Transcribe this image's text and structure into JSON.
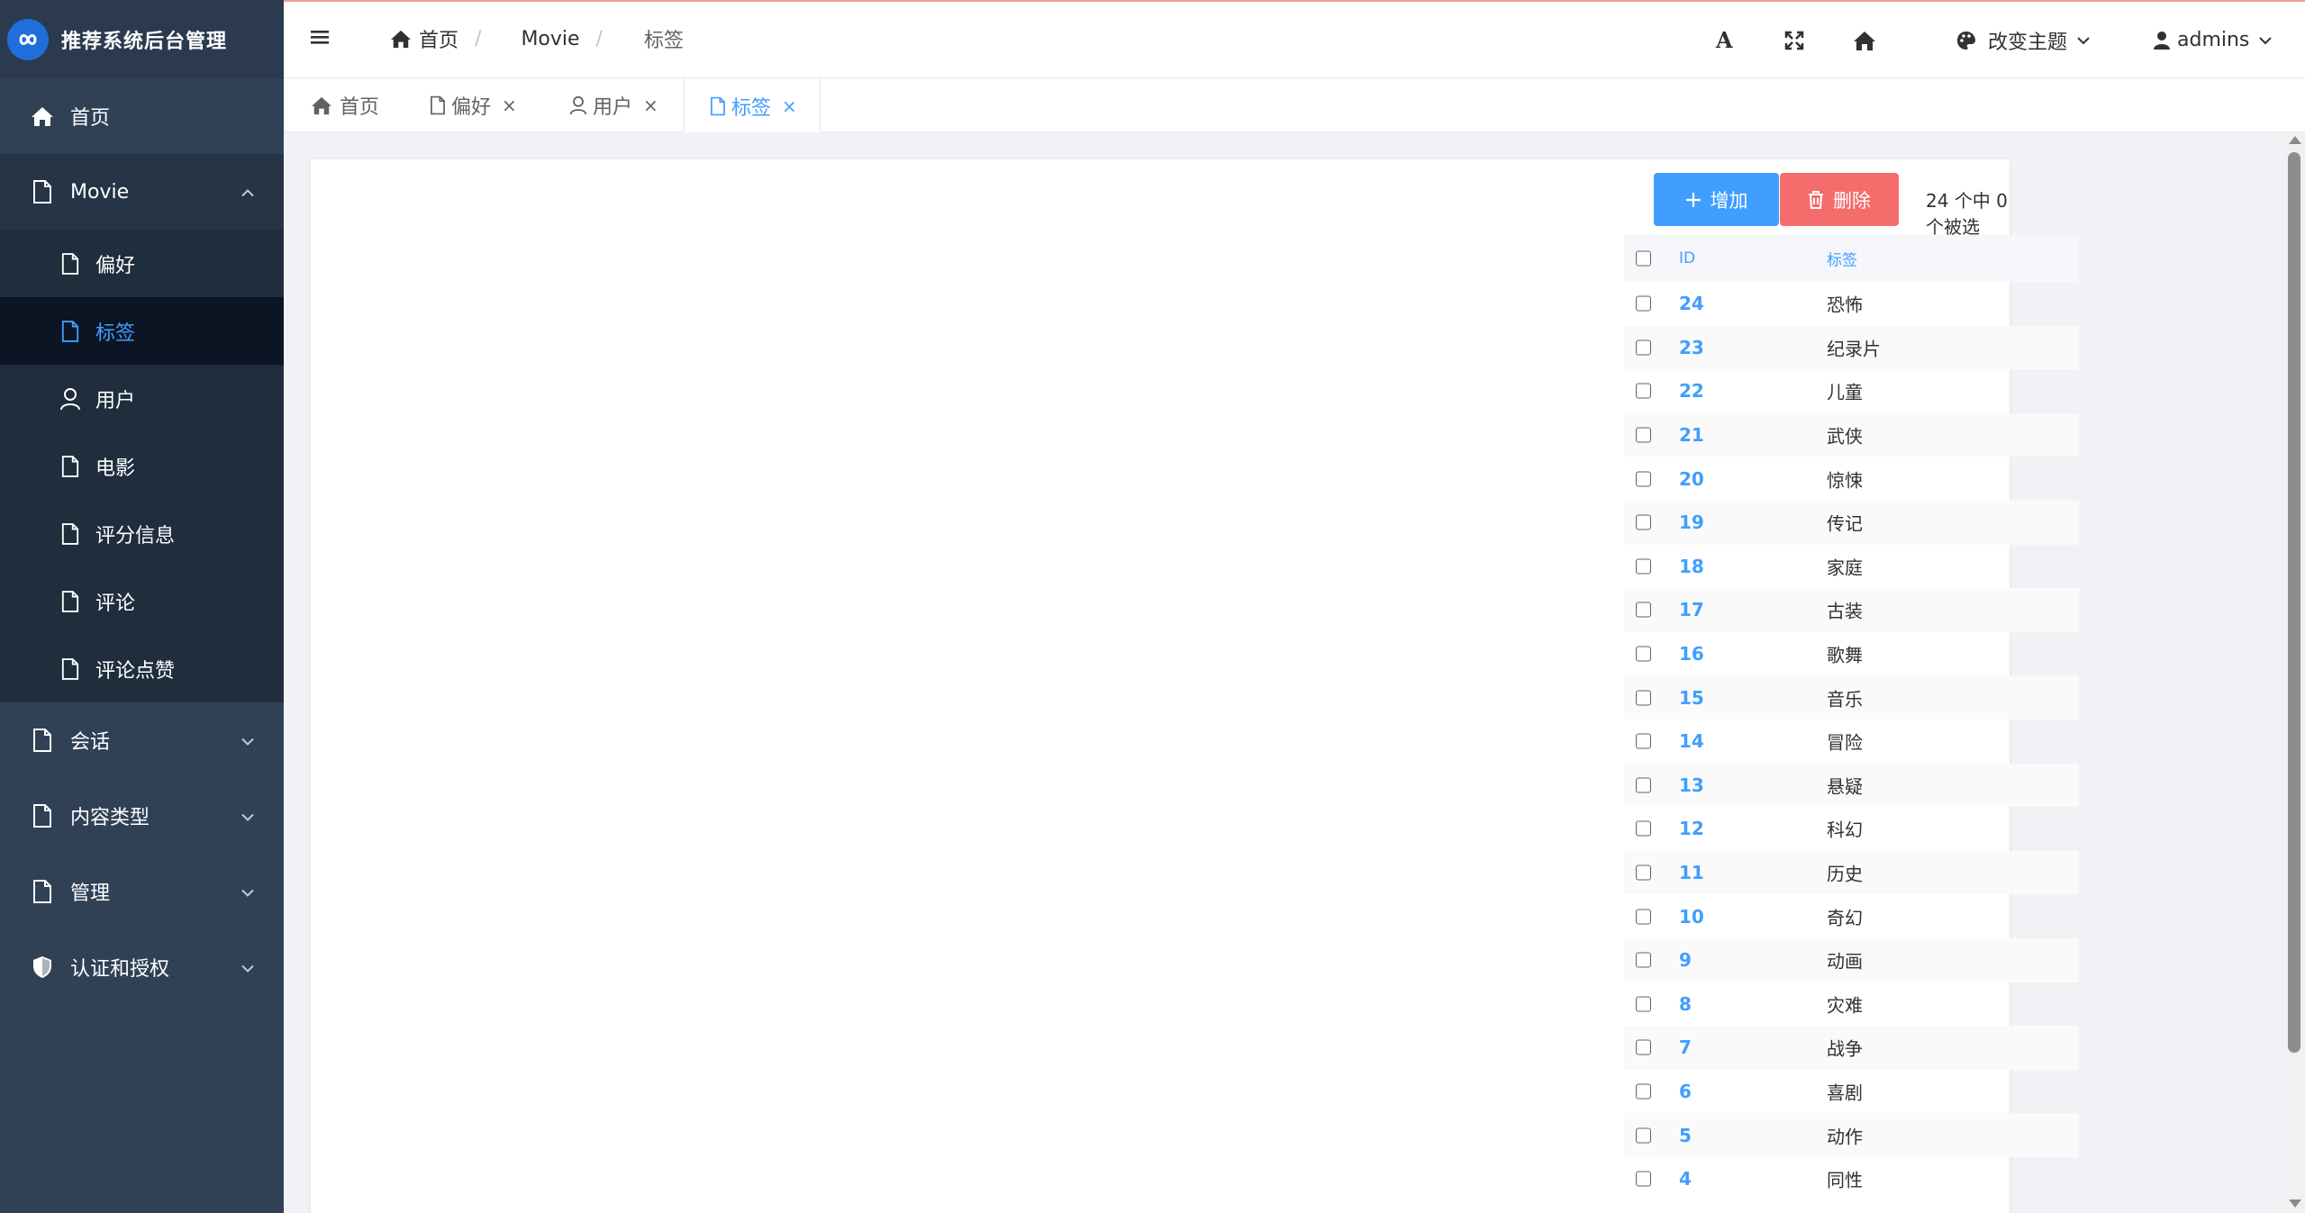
{
  "app": {
    "title": "推荐系统后台管理"
  },
  "sidebar": {
    "home": "首页",
    "movie": {
      "label": "Movie",
      "items": [
        {
          "label": "偏好",
          "active": false
        },
        {
          "label": "标签",
          "active": true
        },
        {
          "label": "用户",
          "active": false
        },
        {
          "label": "电影",
          "active": false
        },
        {
          "label": "评分信息",
          "active": false
        },
        {
          "label": "评论",
          "active": false
        },
        {
          "label": "评论点赞",
          "active": false
        }
      ]
    },
    "groups": [
      "会话",
      "内容类型",
      "管理",
      "认证和授权"
    ]
  },
  "header": {
    "breadcrumb": [
      "首页",
      "Movie",
      "标签"
    ],
    "font_icon": "A",
    "theme_label": "改变主题",
    "user": "admins"
  },
  "tabs": [
    {
      "label": "首页",
      "closable": false,
      "active": false
    },
    {
      "label": "偏好",
      "closable": true,
      "active": false
    },
    {
      "label": "用户",
      "closable": true,
      "active": false
    },
    {
      "label": "标签",
      "closable": true,
      "active": true
    }
  ],
  "toolbar": {
    "add_label": "增加",
    "delete_label": "删除",
    "selection_info": "24 个中 0 个被选"
  },
  "table": {
    "columns": [
      "ID",
      "标签"
    ],
    "rows": [
      [
        "24",
        "恐怖"
      ],
      [
        "23",
        "纪录片"
      ],
      [
        "22",
        "儿童"
      ],
      [
        "21",
        "武侠"
      ],
      [
        "20",
        "惊悚"
      ],
      [
        "19",
        "传记"
      ],
      [
        "18",
        "家庭"
      ],
      [
        "17",
        "古装"
      ],
      [
        "16",
        "歌舞"
      ],
      [
        "15",
        "音乐"
      ],
      [
        "14",
        "冒险"
      ],
      [
        "13",
        "悬疑"
      ],
      [
        "12",
        "科幻"
      ],
      [
        "11",
        "历史"
      ],
      [
        "10",
        "奇幻"
      ],
      [
        "9",
        "动画"
      ],
      [
        "8",
        "灾难"
      ],
      [
        "7",
        "战争"
      ],
      [
        "6",
        "喜剧"
      ],
      [
        "5",
        "动作"
      ],
      [
        "4",
        "同性"
      ]
    ]
  },
  "colors": {
    "sidebar_bg": "#304156",
    "accent": "#409eff",
    "danger": "#f56c6c"
  }
}
